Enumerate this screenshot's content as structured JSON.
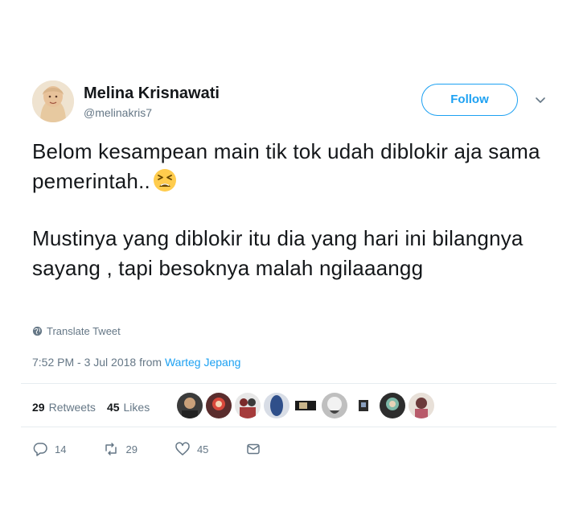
{
  "user": {
    "display_name": "Melina Krisnawati",
    "handle": "@melinakris7",
    "follow_label": "Follow"
  },
  "tweet": {
    "paragraph1": "Belom kesampean main tik tok udah diblokir aja sama pemerintah..",
    "paragraph1_emoji": "tired-face-emoji",
    "paragraph2": "Mustinya yang diblokir itu dia yang hari ini bilangnya sayang , tapi besoknya malah ngilaaangg",
    "translate_label": "Translate Tweet",
    "timestamp": "7:52 PM - 3 Jul 2018",
    "from_label": "from",
    "source": "Warteg Jepang"
  },
  "stats": {
    "retweets_count": "29",
    "retweets_label": "Retweets",
    "likes_count": "45",
    "likes_label": "Likes"
  },
  "actions": {
    "reply_count": "14",
    "retweet_count": "29",
    "like_count": "45"
  },
  "colors": {
    "accent": "#1da1f2",
    "text": "#14171a",
    "muted": "#657786",
    "divider": "#e6ecf0"
  }
}
